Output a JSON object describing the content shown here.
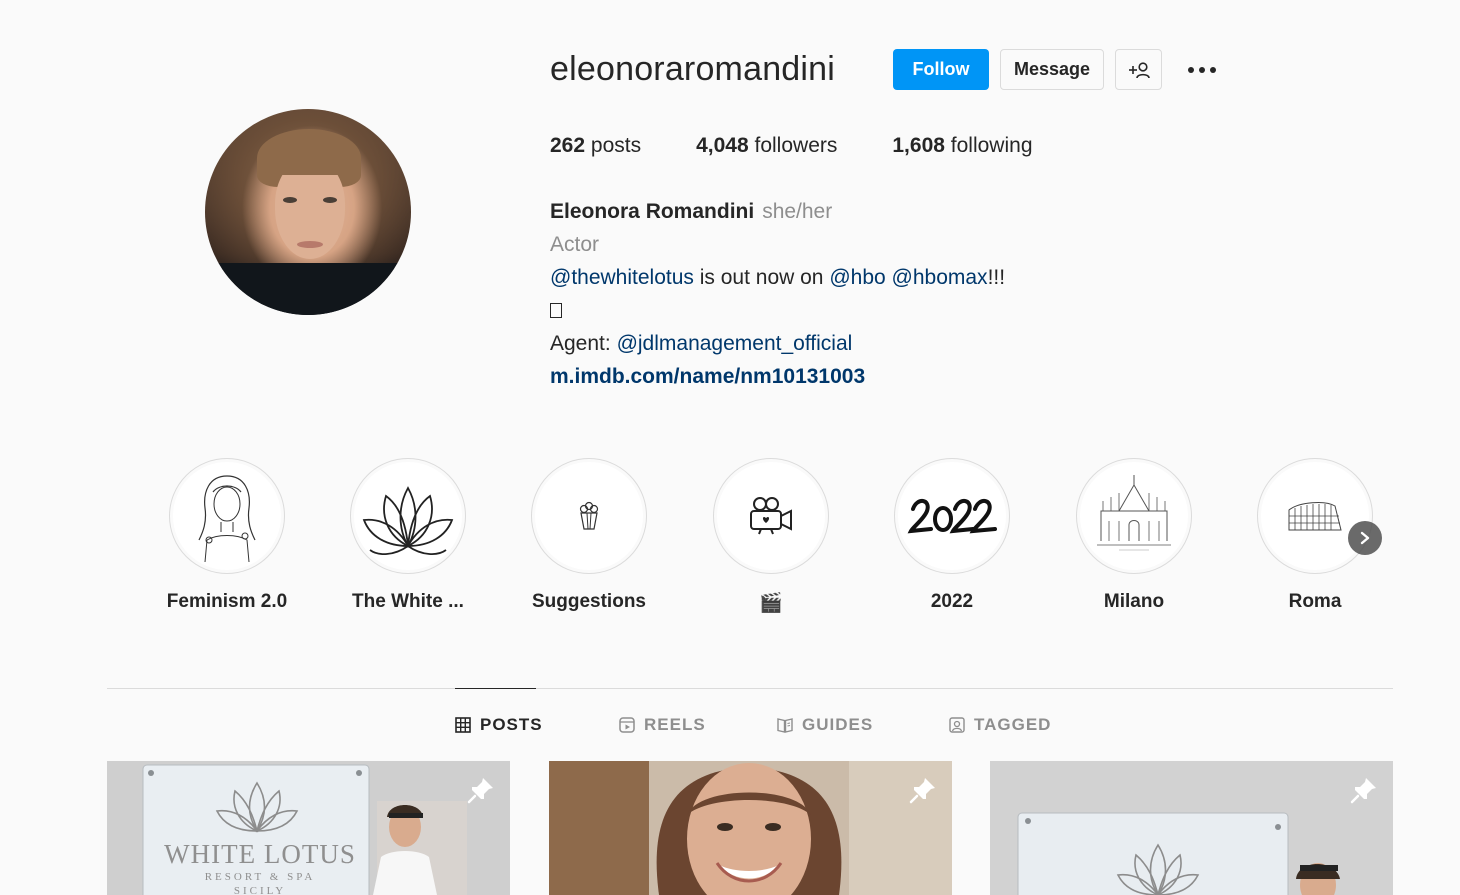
{
  "profile": {
    "username": "eleonoraromandini",
    "follow_label": "Follow",
    "message_label": "Message",
    "stats": {
      "posts_count": "262",
      "posts_label": "posts",
      "followers_count": "4,048",
      "followers_label": "followers",
      "following_count": "1,608",
      "following_label": "following"
    },
    "full_name": "Eleonora Romandini",
    "pronouns": "she/her",
    "category": "Actor",
    "bio_line1_mention1": "@thewhitelotus",
    "bio_line1_text": " is out now on ",
    "bio_line1_mention2": "@hbo",
    "bio_line1_mention3": "@hbomax",
    "bio_line1_end": "!!!",
    "bio_agent_label": "Agent: ",
    "bio_agent_mention": "@jdlmanagement_official",
    "website": "m.imdb.com/name/nm10131003"
  },
  "highlights": [
    {
      "label": "Feminism 2.0",
      "icon": "woman-line-art-icon"
    },
    {
      "label": "The White ...",
      "icon": "lotus-flower-icon"
    },
    {
      "label": "Suggestions",
      "icon": "popcorn-icon"
    },
    {
      "label": "🎬",
      "icon": "movie-camera-icon"
    },
    {
      "label": "2022",
      "icon": "year-2022-lettering"
    },
    {
      "label": "Milano",
      "icon": "milan-cathedral-icon"
    },
    {
      "label": "Roma",
      "icon": "colosseum-icon"
    }
  ],
  "tabs": [
    {
      "label": "POSTS",
      "icon": "grid-icon",
      "active": true
    },
    {
      "label": "REELS",
      "icon": "reels-icon",
      "active": false
    },
    {
      "label": "GUIDES",
      "icon": "guides-icon",
      "active": false
    },
    {
      "label": "TAGGED",
      "icon": "tagged-icon",
      "active": false
    }
  ],
  "posts": [
    {
      "sign_title": "WHITE LOTUS",
      "sign_subtitle": "RESORT & SPA",
      "sign_location": "SICILY",
      "pinned": true
    },
    {
      "pinned": true
    },
    {
      "pinned": true
    }
  ],
  "colors": {
    "follow_button": "#0095f6",
    "link": "#00376b",
    "muted": "#8e8e8e",
    "background": "#fafafa"
  }
}
